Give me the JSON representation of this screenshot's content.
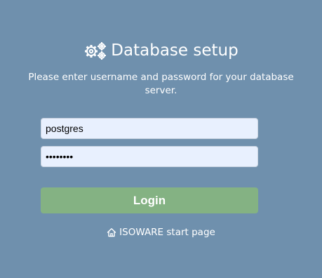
{
  "header": {
    "icon": "gears-icon",
    "title": "Database setup"
  },
  "instructions": "Please enter username and password for your database server.",
  "form": {
    "username_value": "postgres",
    "password_value": "••••••••"
  },
  "login_button_label": "Login",
  "start_link": {
    "icon": "home-icon",
    "label": "ISOWARE start page"
  },
  "colors": {
    "background": "#6f90ad",
    "field_background": "#e8f0fe",
    "button_background": "#84b283",
    "text": "#ffffff"
  }
}
